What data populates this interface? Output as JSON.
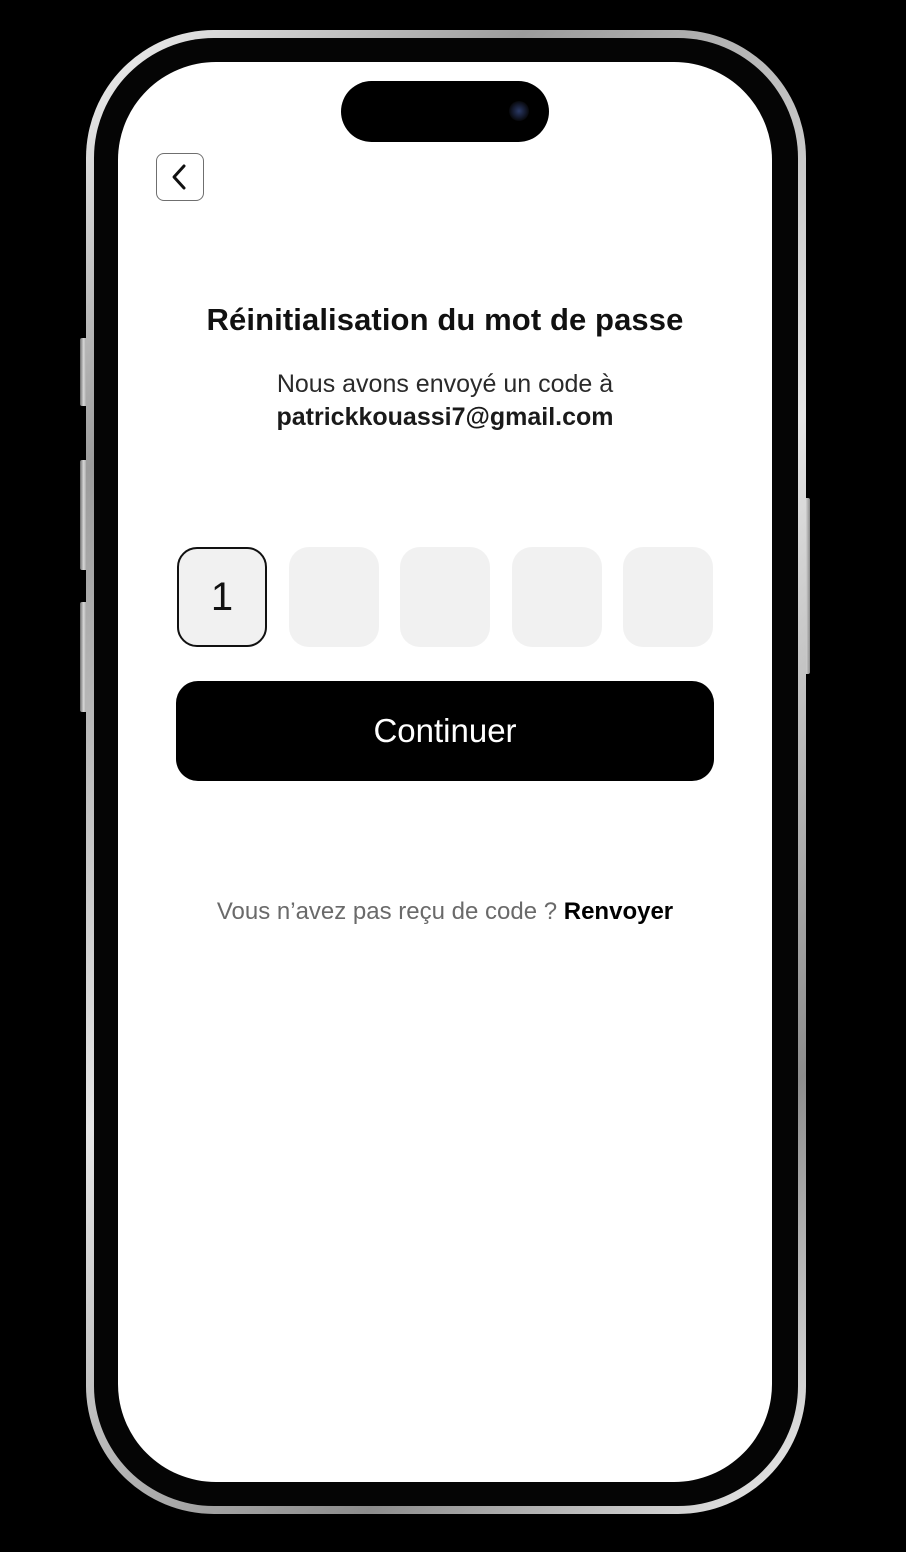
{
  "header": {
    "back_icon": "chevron-left-icon"
  },
  "content": {
    "title": "Réinitialisation du mot de passe",
    "subtitle": "Nous avons envoyé un code à",
    "email": "patrickkouassi7@gmail.com"
  },
  "otp": {
    "digits": [
      "1",
      "",
      "",
      "",
      ""
    ],
    "active_index": 0
  },
  "actions": {
    "continue_label": "Continuer"
  },
  "footer": {
    "prompt": "Vous n’avez pas reçu de code ? ",
    "resend_label": "Renvoyer"
  },
  "colors": {
    "primary": "#000000",
    "input_bg": "#f1f1f1",
    "background": "#ffffff"
  }
}
